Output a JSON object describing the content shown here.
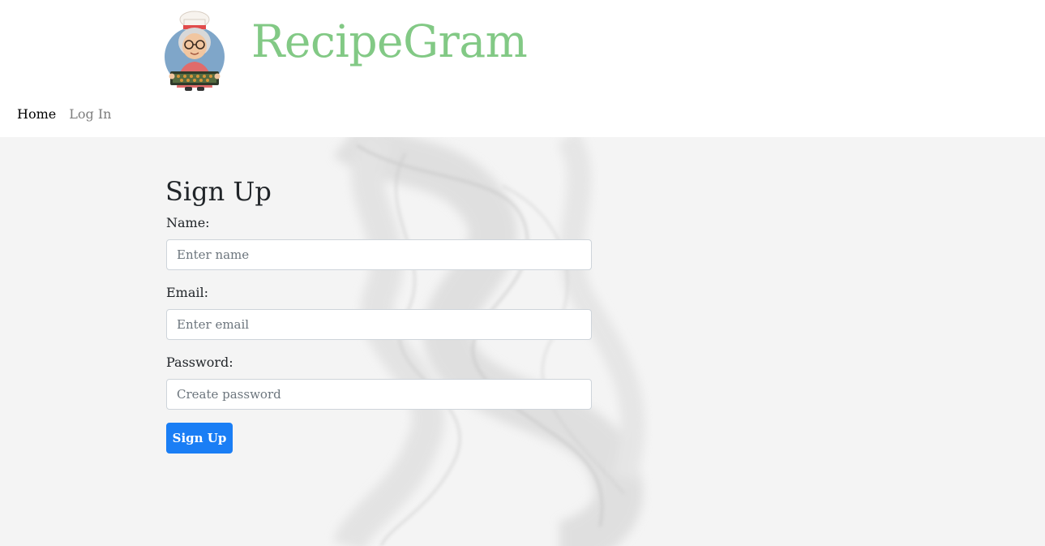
{
  "brand": {
    "name": "RecipeGram",
    "color": "#82c985",
    "logo_icon": "grandma-chef-logo-icon"
  },
  "nav": {
    "items": [
      {
        "label": "Home",
        "active": true
      },
      {
        "label": "Log In",
        "active": false
      }
    ]
  },
  "form": {
    "title": "Sign Up",
    "fields": [
      {
        "label": "Name:",
        "placeholder": "Enter name",
        "value": ""
      },
      {
        "label": "Email:",
        "placeholder": "Enter email",
        "value": ""
      },
      {
        "label": "Password:",
        "placeholder": "Create password",
        "value": ""
      }
    ],
    "submit_label": "Sign Up",
    "submit_color": "#1a7ef5"
  },
  "background": {
    "color": "#f4f4f4",
    "decoration": "smoke-swirl"
  }
}
